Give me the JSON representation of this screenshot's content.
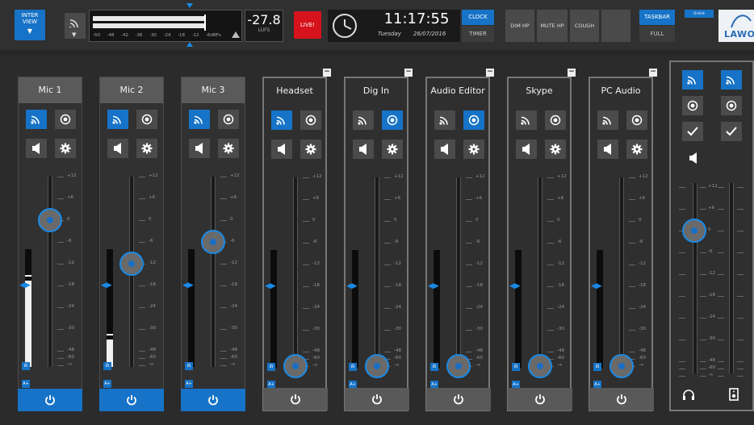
{
  "topbar": {
    "interview_label_1": "INTER",
    "interview_label_2": "VIEW",
    "meter_scale": [
      "-50",
      "-48",
      "-42",
      "-36",
      "-30",
      "-24",
      "-18",
      "-12",
      "-6dBFs"
    ],
    "lufs_value": "-27.8",
    "lufs_unit": "LUFS",
    "live_label": "LIVE!",
    "clock_time": "11:17:55",
    "clock_day": "Tuesday",
    "clock_date": "26/07/2016",
    "clock_btn": "CLOCK",
    "timer_btn": "TIMER",
    "dim_hp": "DIM HP",
    "mute_hp": "MUTE HP",
    "cough": "COUGH",
    "taskbar_btn": "TASKBAR",
    "full_btn": "FULL",
    "onair_tag": "OnAir4",
    "logo_text": "LAWO",
    "accent_color": "#1673c7",
    "live_color": "#d6121c"
  },
  "scale_labels": [
    "+12",
    "+6",
    "0",
    "-6",
    "-12",
    "-18",
    "-24",
    "-30",
    "-48",
    "-60",
    "-∞"
  ],
  "strips": [
    {
      "name": "Mic 1",
      "state": "on",
      "fader_db": "0",
      "meter_level": 0.73,
      "stream_on": true,
      "listen_on": false,
      "minus": false
    },
    {
      "name": "Mic 2",
      "state": "on",
      "fader_db": "-12",
      "meter_level": 0.23,
      "stream_on": true,
      "listen_on": false,
      "minus": false
    },
    {
      "name": "Mic 3",
      "state": "on",
      "fader_db": "-6",
      "meter_level": 0.0,
      "stream_on": true,
      "listen_on": false,
      "minus": false
    },
    {
      "name": "Headset",
      "state": "off",
      "fader_db": "-∞",
      "meter_level": 0.0,
      "stream_on": true,
      "listen_on": false,
      "minus": true
    },
    {
      "name": "Dig In",
      "state": "off",
      "fader_db": "-∞",
      "meter_level": 0.0,
      "stream_on": false,
      "listen_on": true,
      "minus": true
    },
    {
      "name": "Audio Editor",
      "state": "off",
      "fader_db": "-∞",
      "meter_level": 0.0,
      "stream_on": false,
      "listen_on": true,
      "minus": true
    },
    {
      "name": "Skype",
      "state": "off",
      "fader_db": "-∞",
      "meter_level": 0.0,
      "stream_on": false,
      "listen_on": false,
      "minus": true
    },
    {
      "name": "PC Audio",
      "state": "off",
      "fader_db": "-∞",
      "meter_level": 0.0,
      "stream_on": false,
      "listen_on": false,
      "minus": true
    }
  ],
  "master": {
    "fader_db": "0",
    "icons": [
      "wifi-icon",
      "record-icon",
      "check-icon",
      "speaker-icon",
      "headphones-icon",
      "monitor-speaker-icon"
    ]
  }
}
